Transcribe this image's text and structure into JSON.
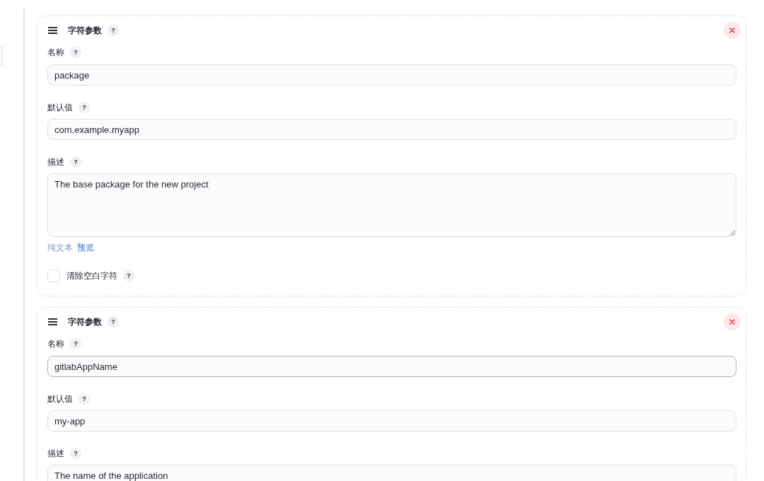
{
  "parameters": [
    {
      "title": "字符参数",
      "help": "?",
      "name": {
        "label": "名称",
        "help": "?",
        "value": "package",
        "focused": false
      },
      "default_value": {
        "label": "默认值",
        "help": "?",
        "value": "com.example.myapp",
        "focused": false
      },
      "description": {
        "label": "描述",
        "help": "?",
        "value": "The base package for the new project",
        "focused": false
      },
      "format": {
        "mode": "纯文本",
        "preview_link": "预览"
      },
      "trim": {
        "label": "清除空白字符",
        "help": "?",
        "checked": false
      }
    },
    {
      "title": "字符参数",
      "help": "?",
      "name": {
        "label": "名称",
        "help": "?",
        "value": "gitlabAppName",
        "focused": true
      },
      "default_value": {
        "label": "默认值",
        "help": "?",
        "value": "my-app",
        "focused": false
      },
      "description": {
        "label": "描述",
        "help": "?",
        "value": "The name of the application",
        "focused": false
      }
    }
  ]
}
